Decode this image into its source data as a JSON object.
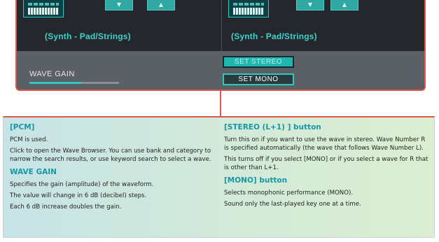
{
  "screen": {
    "left_wave_category": "(Synth - Pad/Strings)",
    "right_wave_category": "(Synth - Pad/Strings)",
    "wave_gain_label": "WAVE GAIN",
    "wave_gain_level": 0.58,
    "set_stereo_label": "SET STEREO",
    "set_mono_label": "SET MONO",
    "arrow_down_glyph": "▼",
    "arrow_up_glyph": "▲",
    "accent_color": "#2fc7bf",
    "callout_color": "#e2564a"
  },
  "description": {
    "left": {
      "pcm_heading": "[PCM]",
      "pcm_lines": [
        "PCM is used.",
        "Click to open the Wave Browser. You can use bank and category to narrow the search results, or use keyword search to select a wave."
      ],
      "gain_heading": "WAVE GAIN",
      "gain_lines": [
        "Specifies the gain (amplitude) of the waveform.",
        "The value will change in 6 dB (decibel) steps.",
        "Each 6 dB increase doubles the gain."
      ]
    },
    "right": {
      "stereo_heading": "[STEREO (L+1) ] button",
      "stereo_lines": [
        "Turn this on if you want to use the wave in stereo. Wave Number R is specified automatically (the wave that follows Wave Number L).",
        "This turns off if you select [MONO] or if you select a wave for R that is other than L+1."
      ],
      "mono_heading": "[MONO] button",
      "mono_lines": [
        "Selects monophonic performance (MONO).",
        "Sound only the last-played key one at a time."
      ]
    }
  }
}
